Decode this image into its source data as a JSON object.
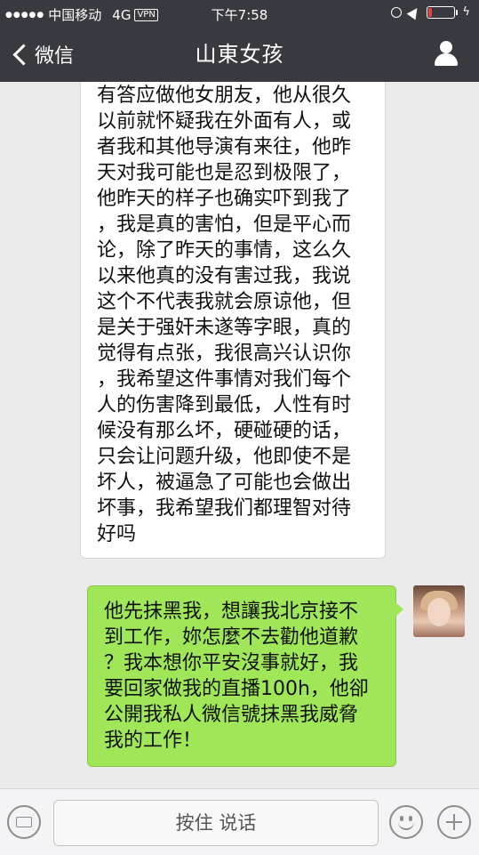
{
  "status_bar": {
    "carrier": "中国移动",
    "network": "4G",
    "vpn": "VPN",
    "time": "下午7:58",
    "battery_level": 0.15,
    "battery_color": "#e64340"
  },
  "nav": {
    "back_label": "微信",
    "title": "山東女孩",
    "right_icon": "profile-icon"
  },
  "messages": [
    {
      "side": "incoming",
      "text": "有答应做他女朋友，他从很久\n以前就怀疑我在外面有人，或\n者我和其他导演有来往，他昨\n天对我可能也是忍到极限了，\n他昨天的样子也确实吓到我了\n，我是真的害怕，但是平心而\n论，除了昨天的事情，这么久\n以来他真的没有害过我，我说\n这个不代表我就会原谅他，但\n是关于强奸未遂等字眼，真的\n觉得有点张，我很高兴认识你\n，我希望这件事情对我们每个\n人的伤害降到最低，人性有时\n候没有那么坏，硬碰硬的话，\n只会让问题升级，他即使不是\n坏人，被逼急了可能也会做出\n坏事，我希望我们都理智对待\n好吗"
    },
    {
      "side": "outgoing",
      "text": "他先抹黑我，想讓我北京接不\n到工作，妳怎麼不去勸他道歉\n？我本想你平安沒事就好，我\n要回家做我的直播100h，他卻\n公開我私人微信號抹黑我威脅\n我的工作！"
    }
  ],
  "input_bar": {
    "left_icon": "keyboard-icon",
    "talk_label": "按住 说话",
    "emoji_icon": "emoji-icon",
    "plus_icon": "plus-icon"
  },
  "colors": {
    "nav_bg": "#393a3f",
    "chat_bg": "#ebebeb",
    "outgoing_bubble": "#9fe658",
    "incoming_bubble": "#ffffff"
  }
}
